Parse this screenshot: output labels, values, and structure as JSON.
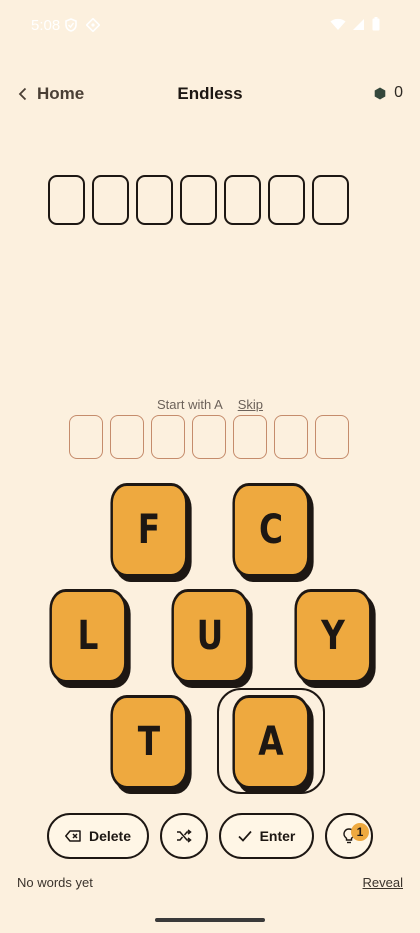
{
  "status": {
    "time": "5:08"
  },
  "header": {
    "back_label": "Home",
    "title": "Endless",
    "score": "0"
  },
  "hint": {
    "text": "Start with A",
    "skip_label": "Skip"
  },
  "tiles": [
    {
      "letter": "F"
    },
    {
      "letter": "C"
    },
    {
      "letter": "L"
    },
    {
      "letter": "U"
    },
    {
      "letter": "Y"
    },
    {
      "letter": "T"
    },
    {
      "letter": "A"
    }
  ],
  "buttons": {
    "delete_label": "Delete",
    "enter_label": "Enter",
    "hint_count": "1"
  },
  "footer": {
    "words_text": "No words yet",
    "reveal_label": "Reveal"
  },
  "colors": {
    "background": "#fcf0de",
    "tile": "#eea93f",
    "ink": "#1d1713"
  }
}
